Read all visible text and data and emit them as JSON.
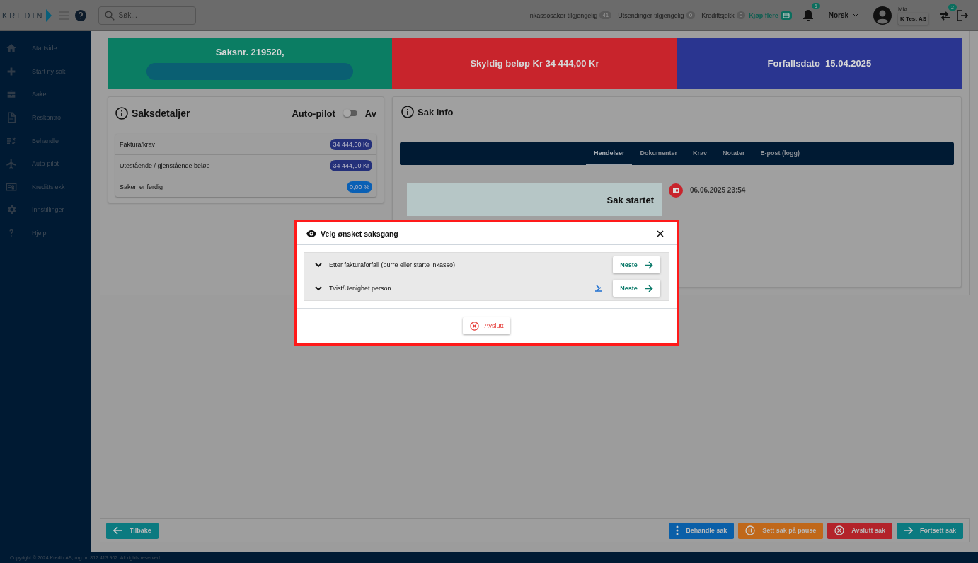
{
  "header": {
    "logo": "KREDIN",
    "search": {
      "placeholder": "Søk..."
    },
    "counters": [
      {
        "label": "Inkassosaker tilgjengelig",
        "count": "41"
      },
      {
        "label": "Utsendinger tilgjengelig",
        "count": "0"
      },
      {
        "label": "Kredittsjekk",
        "count": "0"
      }
    ],
    "buy_link": "Kjøp flere",
    "notifications": {
      "count": "6"
    },
    "language": "Norsk",
    "user": {
      "name": "Mia",
      "company": "K Test AS"
    },
    "switch": {
      "count": "2"
    }
  },
  "sidebar": {
    "items": [
      {
        "label": "Startside"
      },
      {
        "label": "Start ny sak"
      },
      {
        "label": "Saker"
      },
      {
        "label": "Reskontro"
      },
      {
        "label": "Behandle"
      },
      {
        "label": "Auto-pilot"
      },
      {
        "label": "Kredittsjekk"
      },
      {
        "label": "Innstillinger"
      },
      {
        "label": "Hjelp"
      }
    ]
  },
  "summary": [
    {
      "text": "Saksnr. 219520,",
      "kind": "case"
    },
    {
      "text": "Skyldig beløp Kr 34 444,00 Kr",
      "kind": "debt"
    },
    {
      "text": "Forfallsdato  15.04.2025",
      "kind": "due"
    }
  ],
  "details": {
    "title": "Saksdetaljer",
    "autopilot": {
      "label": "Auto-pilot",
      "on": false,
      "state_text": "Av"
    },
    "rows": [
      {
        "label": "Faktura/krav",
        "value": "34 444,00 Kr",
        "kind": "amount"
      },
      {
        "label": "Utestående / gjenstående beløp",
        "value": "34 444,00 Kr",
        "kind": "amount"
      },
      {
        "label": "Saken er ferdig",
        "value": "0,00 %",
        "kind": "percent"
      }
    ]
  },
  "info": {
    "title": "Sak info",
    "tabs": [
      {
        "label": "Hendelser",
        "selected": true
      },
      {
        "label": "Dokumenter",
        "selected": false
      },
      {
        "label": "Krav",
        "selected": false
      },
      {
        "label": "Notater",
        "selected": false
      },
      {
        "label": "E-post (logg)",
        "selected": false
      }
    ],
    "events": [
      {
        "title": "Sak startet",
        "time": "06.06.2025 23:54"
      }
    ]
  },
  "actions": {
    "back": "Tilbake",
    "buttons": [
      {
        "label": "Behandle sak",
        "kind": "process"
      },
      {
        "label": "Sett sak på pause",
        "kind": "pause"
      },
      {
        "label": "Avslutt sak",
        "kind": "close"
      },
      {
        "label": "Fortsett sak",
        "kind": "continue"
      }
    ]
  },
  "footer": "Copyright © 2024 Kredin AS, org.nr. 812 413 902. All rights reserved.",
  "dialog": {
    "title": "Velg ønsket saksgang",
    "options": [
      {
        "label": "Etter fakturaforfall (purre eller starte inkasso)",
        "expanded": false,
        "pinned": false,
        "next": "Neste"
      },
      {
        "label": "Tvist/Uenighet person",
        "expanded": false,
        "pinned": true,
        "next": "Neste"
      }
    ],
    "cancel": "Avslutt"
  }
}
